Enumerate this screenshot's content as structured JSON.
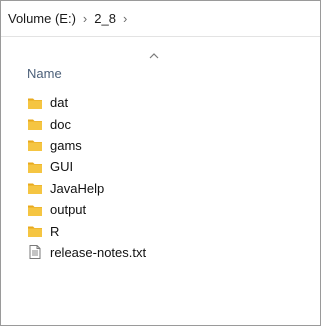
{
  "breadcrumb": {
    "items": [
      "Volume (E:)",
      "2_8"
    ],
    "separator": "›"
  },
  "column_header": {
    "name_label": "Name",
    "sort_icon": "sort-ascending-icon"
  },
  "files": [
    {
      "name": "dat",
      "type": "folder",
      "icon": "folder-icon"
    },
    {
      "name": "doc",
      "type": "folder",
      "icon": "folder-icon"
    },
    {
      "name": "gams",
      "type": "folder",
      "icon": "folder-icon"
    },
    {
      "name": "GUI",
      "type": "folder",
      "icon": "folder-icon"
    },
    {
      "name": "JavaHelp",
      "type": "folder",
      "icon": "folder-icon"
    },
    {
      "name": "output",
      "type": "folder",
      "icon": "folder-icon"
    },
    {
      "name": "R",
      "type": "folder",
      "icon": "folder-icon"
    },
    {
      "name": "release-notes.txt",
      "type": "file",
      "icon": "text-file-icon"
    }
  ],
  "colors": {
    "folder": "#f5c542",
    "folder_back": "#e8a91d",
    "header_text": "#4c607a",
    "border": "#9a9a9a"
  }
}
